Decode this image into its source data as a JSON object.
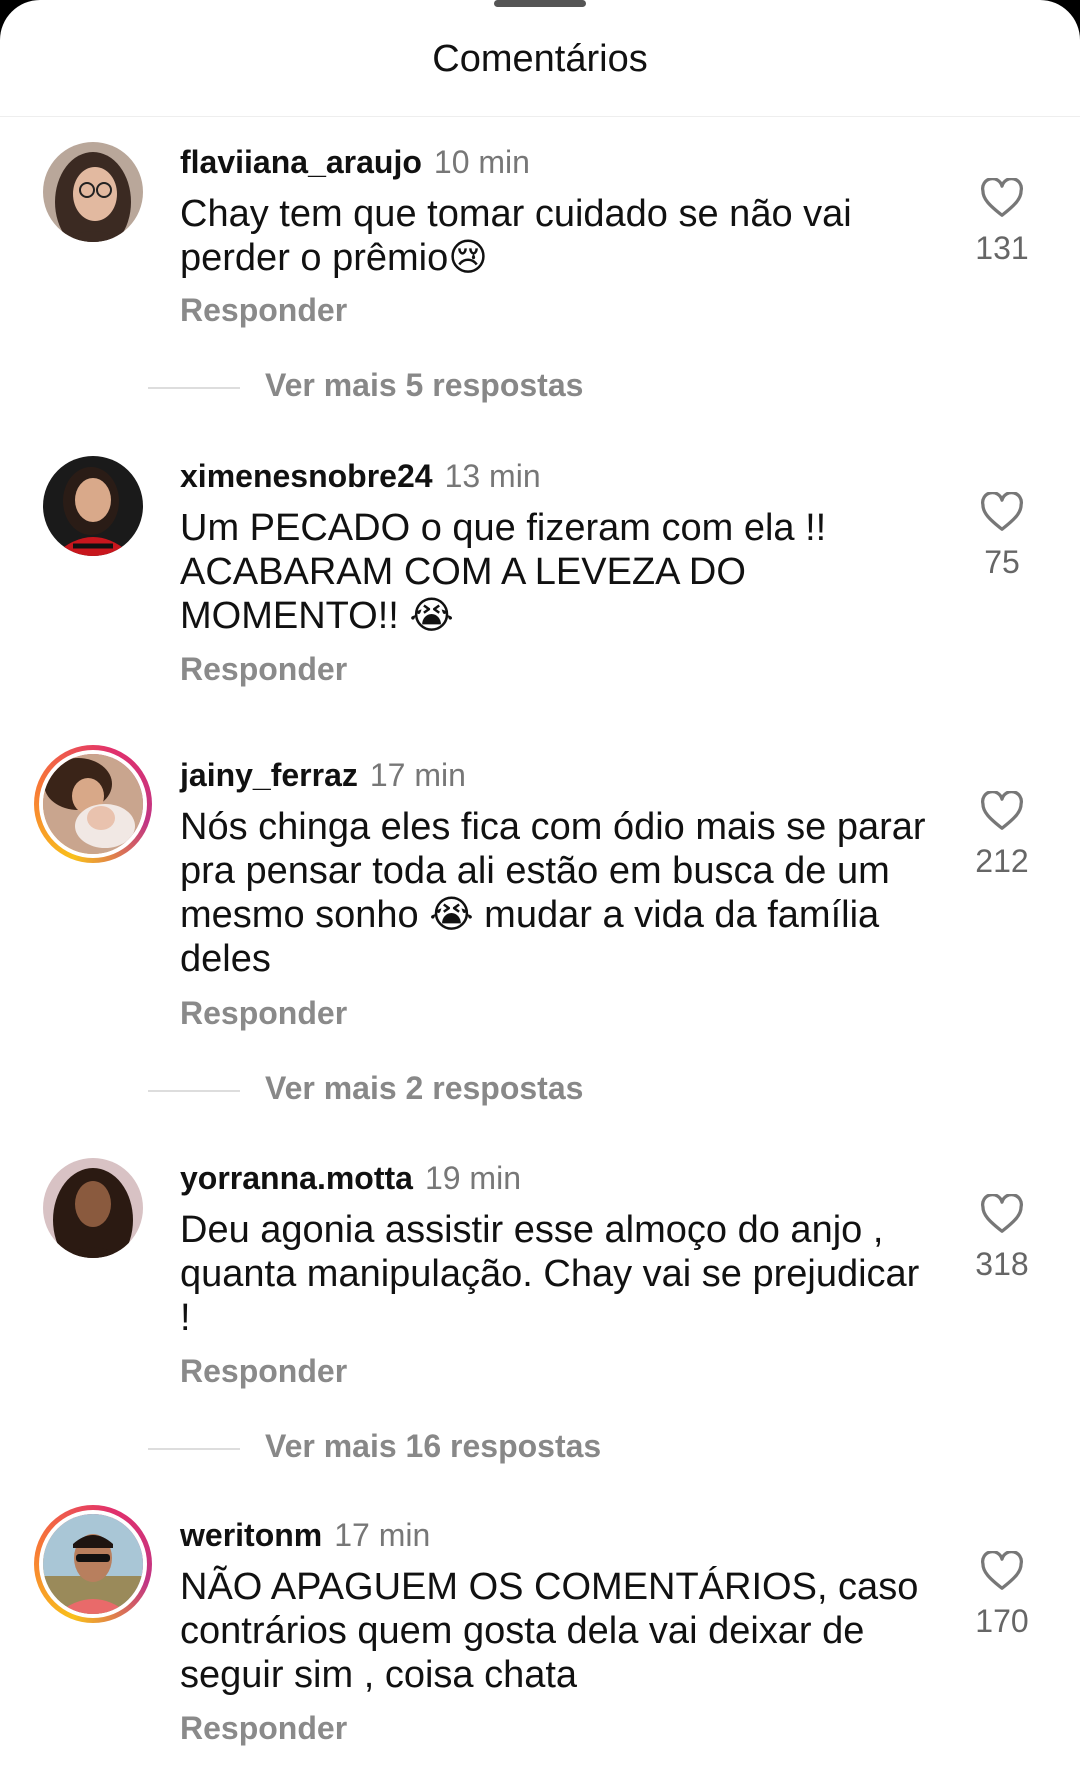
{
  "sheet": {
    "title": "Comentários"
  },
  "comments": [
    {
      "username": "flaviiana_araujo",
      "time": "10 min",
      "text": "Chay tem que tomar cuidado se não vai perder o prêmio😢",
      "likes": "131",
      "reply_label": "Responder",
      "more_replies": "Ver mais 5 respostas",
      "has_story": false
    },
    {
      "username": "ximenesnobre24",
      "time": "13 min",
      "text": "Um  PECADO o que fizeram com ela !! ACABARAM COM A LEVEZA DO MOMENTO!! 😭",
      "likes": "75",
      "reply_label": "Responder",
      "has_story": false
    },
    {
      "username": "jainy_ferraz",
      "time": "17 min",
      "text": "Nós chinga eles fica com ódio mais se parar pra pensar toda ali estão em busca de um mesmo sonho 😭 mudar a vida da família deles",
      "likes": "212",
      "reply_label": "Responder",
      "more_replies": "Ver mais 2 respostas",
      "has_story": true
    },
    {
      "username": "yorranna.motta",
      "time": "19 min",
      "text": "Deu agonia assistir esse almoço do anjo , quanta manipulação. Chay vai se prejudicar !",
      "likes": "318",
      "reply_label": "Responder",
      "more_replies": "Ver mais 16 respostas",
      "has_story": false
    },
    {
      "username": "weritonm",
      "time": "17 min",
      "text": "NÃO APAGUEM OS COMENTÁRIOS, caso contrários quem gosta dela vai deixar de seguir sim , coisa chata",
      "likes": "170",
      "reply_label": "Responder",
      "has_story": true
    }
  ],
  "icons": {
    "like": "heart-outline-icon"
  },
  "colors": {
    "story_ring": "#e1306c",
    "muted_text": "#888888"
  }
}
